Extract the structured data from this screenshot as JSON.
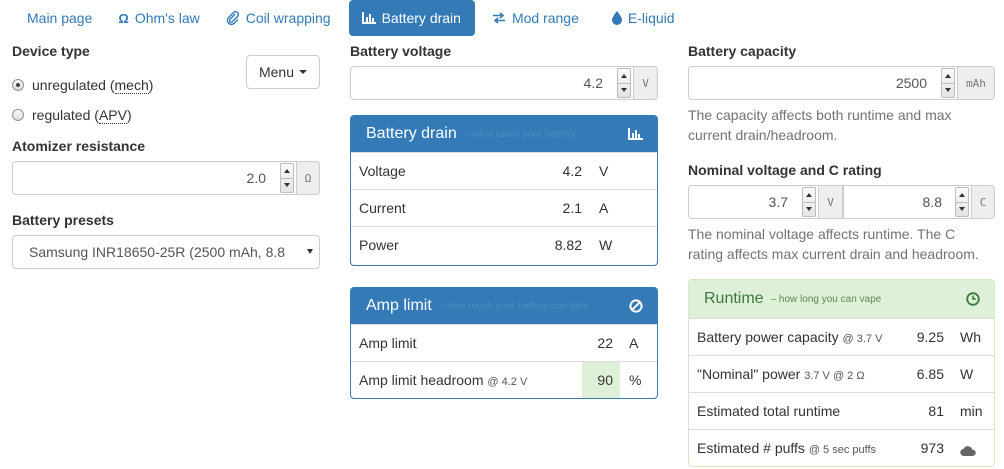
{
  "nav": {
    "tabs": [
      {
        "label": "Main page",
        "icon": "",
        "active": false
      },
      {
        "label": "Ohm's law",
        "icon": "omega-icon",
        "active": false
      },
      {
        "label": "Coil wrapping",
        "icon": "paperclip-icon",
        "active": false
      },
      {
        "label": "Battery drain",
        "icon": "bar-chart-icon",
        "active": true
      },
      {
        "label": "Mod range",
        "icon": "transfer-arrows-icon",
        "active": false
      },
      {
        "label": "E-liquid",
        "icon": "droplet-icon",
        "active": false
      }
    ],
    "omega_glyph": "Ω"
  },
  "device": {
    "label": "Device type",
    "menu_label": "Menu",
    "options": [
      {
        "label_prefix": "unregulated (",
        "abbr": "mech",
        "label_suffix": ")",
        "checked": true
      },
      {
        "label_prefix": "regulated (",
        "abbr": "APV",
        "label_suffix": ")",
        "checked": false
      }
    ]
  },
  "atomizer": {
    "label": "Atomizer resistance",
    "value": "2.0",
    "unit": "Ω"
  },
  "presets": {
    "label": "Battery presets",
    "selected": "Samsung INR18650-25R (2500 mAh, 8.8"
  },
  "voltage": {
    "label": "Battery voltage",
    "value": "4.2",
    "unit": "V"
  },
  "drain_panel": {
    "title": "Battery drain",
    "subtitle": "– what takes your battery",
    "rows": [
      {
        "name": "Voltage",
        "value": "4.2",
        "unit": "V"
      },
      {
        "name": "Current",
        "value": "2.1",
        "unit": "A"
      },
      {
        "name": "Power",
        "value": "8.82",
        "unit": "W"
      }
    ]
  },
  "amp_panel": {
    "title": "Amp limit",
    "subtitle": "– how much your battery can take",
    "rows": [
      {
        "name": "Amp limit",
        "note": "",
        "value": "22",
        "unit": "A"
      },
      {
        "name": "Amp limit headroom",
        "note": "@ 4.2 V",
        "value": "90",
        "unit": "%"
      }
    ]
  },
  "capacity": {
    "label": "Battery capacity",
    "value": "2500",
    "unit": "mAh",
    "help": "The capacity affects both runtime and max current drain/headroom."
  },
  "nominal": {
    "label": "Nominal voltage and C rating",
    "voltage_value": "3.7",
    "voltage_unit": "V",
    "c_value": "8.8",
    "c_unit": "C",
    "help": "The nominal voltage affects runtime. The C rating affects max current drain and headroom."
  },
  "runtime_panel": {
    "title": "Runtime",
    "subtitle": "– how long you can vape",
    "rows": [
      {
        "name": "Battery power capacity",
        "note": "@ 3.7 V",
        "value": "9.25",
        "unit": "Wh"
      },
      {
        "name": "\"Nominal\" power",
        "note": "3.7 V @ 2 Ω",
        "value": "6.85",
        "unit": "W"
      },
      {
        "name": "Estimated total runtime",
        "note": "",
        "value": "81",
        "unit": "min"
      },
      {
        "name": "Estimated # puffs",
        "note": "@ 5 sec puffs",
        "value": "973",
        "unit": "cloud-icon"
      }
    ]
  },
  "colors": {
    "primary": "#337ab7",
    "success_bg": "#dff0d8",
    "success_text": "#3c763d",
    "muted": "#737373"
  }
}
